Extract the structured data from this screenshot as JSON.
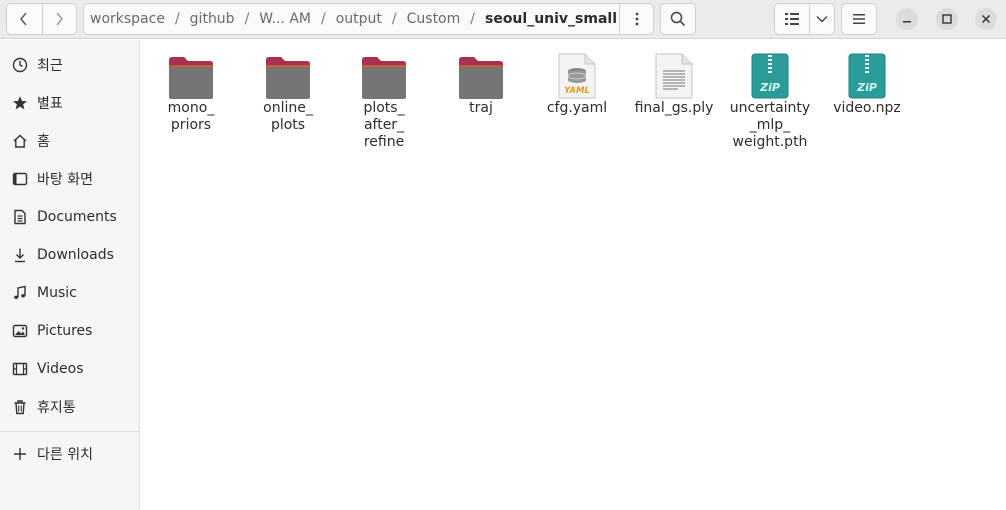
{
  "header": {
    "breadcrumbs": [
      "workspace",
      "github",
      "W... AM",
      "output",
      "Custom",
      "seoul_univ_small"
    ],
    "separator": "/"
  },
  "sidebar": {
    "items": [
      {
        "label": "최근",
        "icon": "clock-icon"
      },
      {
        "label": "별표",
        "icon": "star-icon"
      },
      {
        "label": "홈",
        "icon": "home-icon"
      },
      {
        "label": "바탕 화면",
        "icon": "desktop-icon"
      },
      {
        "label": "Documents",
        "icon": "document-icon"
      },
      {
        "label": "Downloads",
        "icon": "download-icon"
      },
      {
        "label": "Music",
        "icon": "music-icon"
      },
      {
        "label": "Pictures",
        "icon": "picture-icon"
      },
      {
        "label": "Videos",
        "icon": "video-icon"
      },
      {
        "label": "휴지통",
        "icon": "trash-icon"
      }
    ],
    "other_locations": {
      "label": "다른 위치",
      "icon": "plus-icon"
    }
  },
  "files": [
    {
      "name": "mono_\npriors",
      "type": "folder"
    },
    {
      "name": "online_\nplots",
      "type": "folder"
    },
    {
      "name": "plots_\nafter_\nrefine",
      "type": "folder"
    },
    {
      "name": "traj",
      "type": "folder"
    },
    {
      "name": "cfg.yaml",
      "type": "yaml",
      "badge": "YAML"
    },
    {
      "name": "final_gs.ply",
      "type": "text"
    },
    {
      "name": "uncertainty\n_mlp_\nweight.pth",
      "type": "zip",
      "badge": "ZiP"
    },
    {
      "name": "video.npz",
      "type": "zip",
      "badge": "ZiP"
    }
  ],
  "colors": {
    "folder_body": "#757575",
    "folder_tab": "#a8324c",
    "zip": "#2a9d9a"
  }
}
